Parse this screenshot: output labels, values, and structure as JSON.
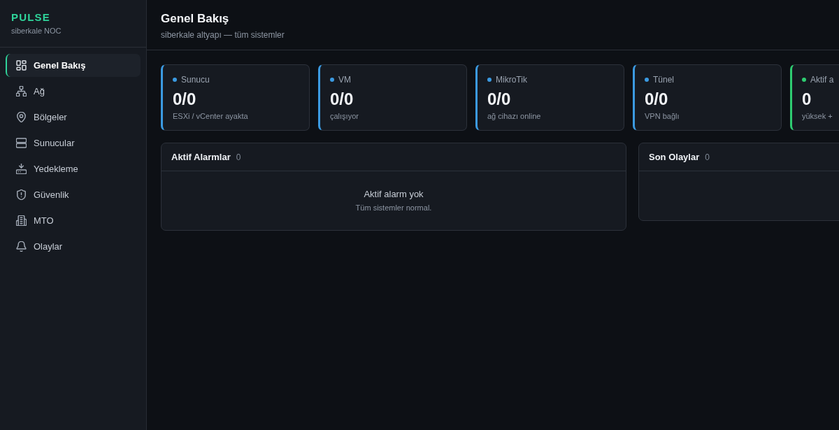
{
  "brand": {
    "name": "PULSE",
    "subtitle": "siberkale NOC"
  },
  "sidebar": {
    "items": [
      {
        "label": "Genel Bakış",
        "selected": true
      },
      {
        "label": "Ağ",
        "selected": false
      },
      {
        "label": "Bölgeler",
        "selected": false
      },
      {
        "label": "Sunucular",
        "selected": false
      },
      {
        "label": "Yedekleme",
        "selected": false
      },
      {
        "label": "Güvenlik",
        "selected": false
      },
      {
        "label": "MTO",
        "selected": false
      },
      {
        "label": "Olaylar",
        "selected": false
      }
    ]
  },
  "header": {
    "title": "Genel Bakış",
    "subtitle": "siberkale altyapı — tüm sistemler"
  },
  "stat_cards": [
    {
      "label": "Sunucu",
      "value": "0/0",
      "caption": "ESXi / vCenter ayakta",
      "color": "#3b9ae1"
    },
    {
      "label": "VM",
      "value": "0/0",
      "caption": "çalışıyor",
      "color": "#3b9ae1"
    },
    {
      "label": "MikroTik",
      "value": "0/0",
      "caption": "ağ cihazı online",
      "color": "#3b9ae1"
    },
    {
      "label": "Tünel",
      "value": "0/0",
      "caption": "VPN bağlı",
      "color": "#3b9ae1"
    },
    {
      "label": "Aktif a",
      "value": "0",
      "caption": "yüksek +",
      "color": "#2ecc71"
    }
  ],
  "panels": [
    {
      "title": "Aktif Alarmlar",
      "count": "0",
      "empty_title": "Aktif alarm yok",
      "empty_text": "Tüm sistemler normal."
    },
    {
      "title": "Son Olaylar",
      "count": "0"
    }
  ]
}
